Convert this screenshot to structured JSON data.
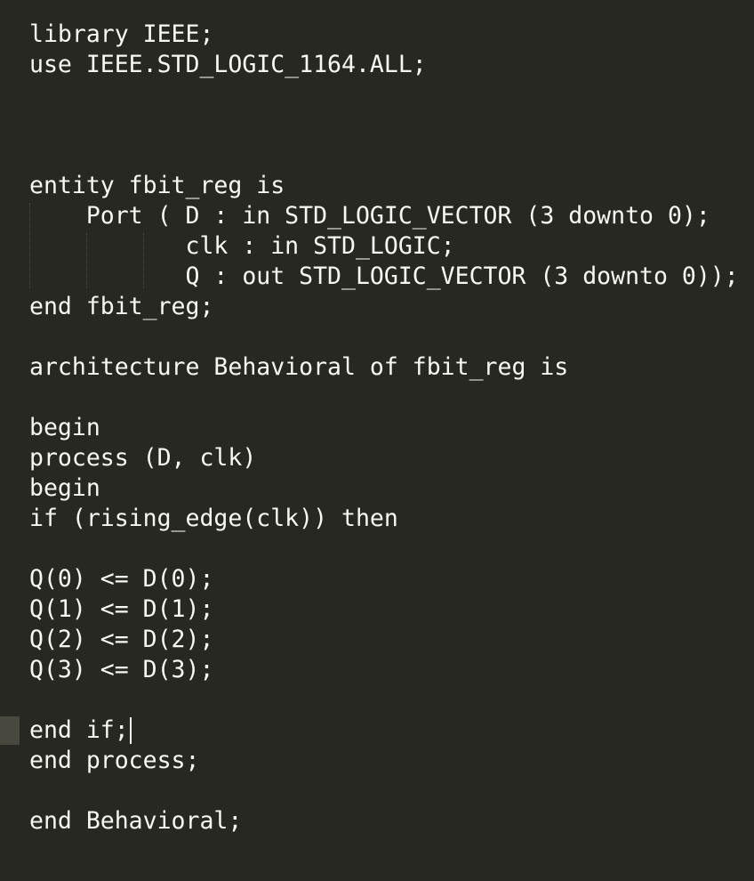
{
  "editor": {
    "background_color": "#272822",
    "text_color": "#f8f8f2",
    "current_line_marker_color": "#49483e",
    "lines": [
      "library IEEE;",
      "use IEEE.STD_LOGIC_1164.ALL;",
      "",
      "",
      "",
      "entity fbit_reg is",
      "    Port ( D : in STD_LOGIC_VECTOR (3 downto 0);",
      "           clk : in STD_LOGIC;",
      "           Q : out STD_LOGIC_VECTOR (3 downto 0));",
      "end fbit_reg;",
      "",
      "architecture Behavioral of fbit_reg is",
      "",
      "begin",
      "process (D, clk)",
      "begin",
      "if (rising_edge(clk)) then",
      "",
      "Q(0) <= D(0);",
      "Q(1) <= D(1);",
      "Q(2) <= D(2);",
      "Q(3) <= D(3);",
      "",
      "end if;",
      "end process;",
      "",
      "end Behavioral;"
    ],
    "cursor_line_index": 23
  }
}
